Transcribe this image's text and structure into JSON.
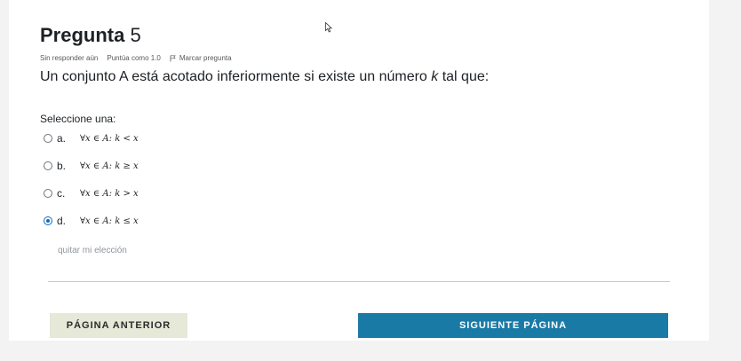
{
  "question": {
    "label": "Pregunta",
    "number": "5",
    "status": "Sin responder aún",
    "grade": "Puntúa como 1.0",
    "flag_label": "Marcar pregunta",
    "text_before": "Un conjunto A está acotado inferiormente si existe un número ",
    "text_var": "k",
    "text_after": " tal que:"
  },
  "prompt": "Seleccione una:",
  "options": [
    {
      "letter": "a.",
      "math": "∀x ∈ A: k < x",
      "selected": false
    },
    {
      "letter": "b.",
      "math": "∀x ∈ A: k ≥ x",
      "selected": false
    },
    {
      "letter": "c.",
      "math": "∀x ∈ A: k > x",
      "selected": false
    },
    {
      "letter": "d.",
      "math": "∀x ∈ A: k ≤ x",
      "selected": true
    }
  ],
  "clear_choice": "quitar mi elección",
  "navigation": {
    "prev_label": "PÁGINA ANTERIOR",
    "next_label": "SIGUIENTE PÁGINA"
  },
  "colors": {
    "accent": "#0f6cbf",
    "next_button": "#1a7aa6",
    "prev_button": "#e6e8d8"
  },
  "icons": {
    "flag": "flag-icon",
    "cursor": "mouse-pointer-icon"
  }
}
